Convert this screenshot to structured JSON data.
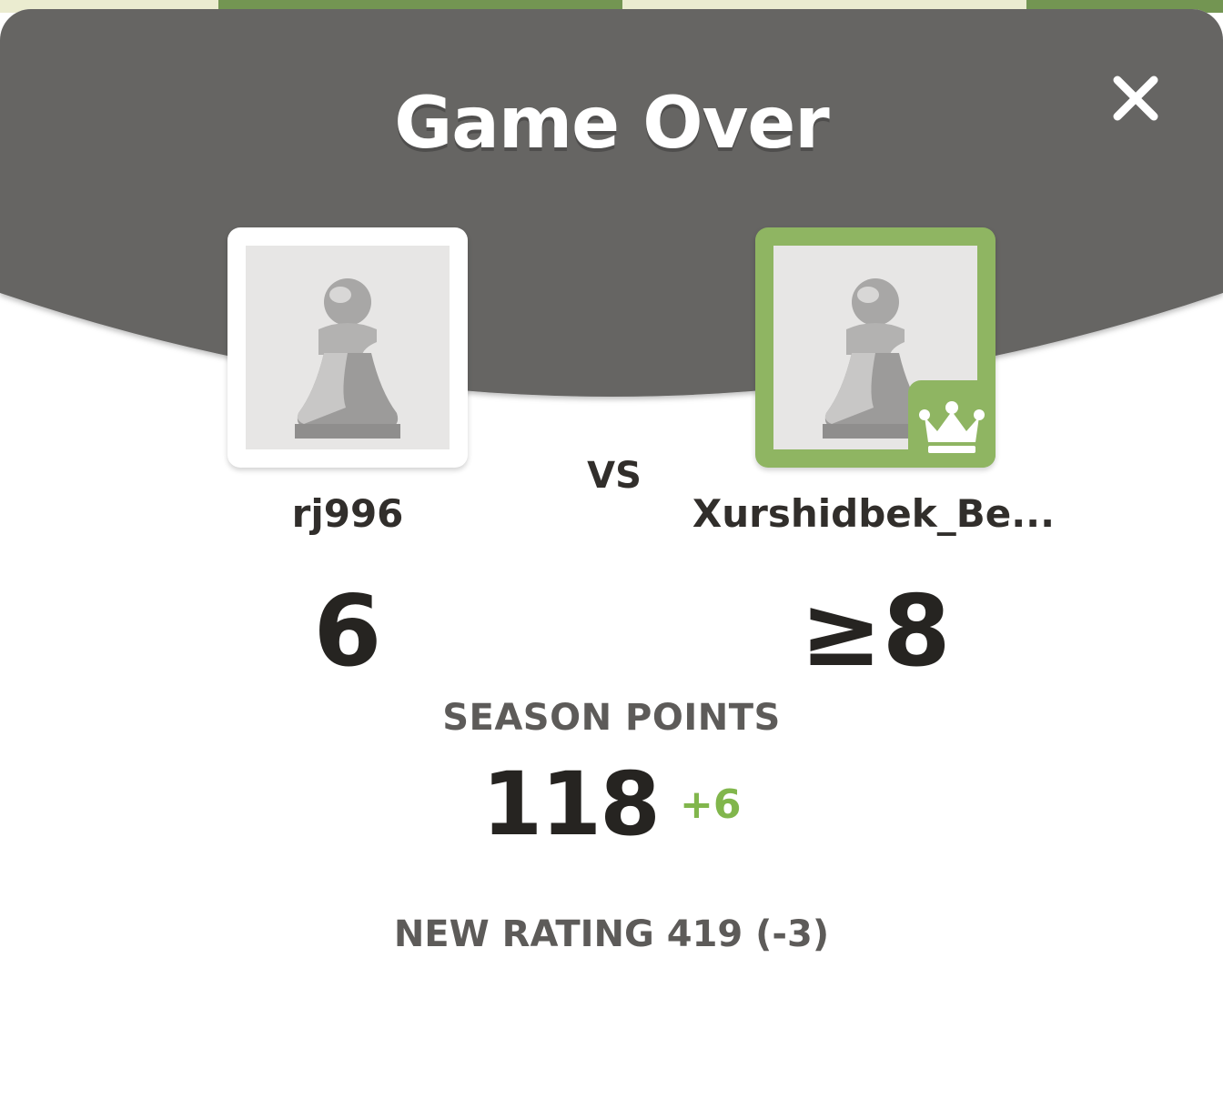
{
  "modal": {
    "title": "Game Over",
    "close_icon": "close-icon",
    "header_color": "#666564",
    "accent_color": "#81b64c"
  },
  "players": {
    "left": {
      "name": "rj996",
      "score": "6",
      "avatar_icon": "pawn-icon",
      "winner": false
    },
    "vs_label": "VS",
    "right": {
      "name": "Xurshidbek_Be...",
      "score": "≥8",
      "avatar_icon": "pawn-icon",
      "badge_icon": "crown-icon",
      "winner": true
    }
  },
  "season": {
    "label": "SEASON POINTS",
    "value": "118",
    "delta": "+6"
  },
  "rating": {
    "text": "NEW RATING 419 (-3)"
  }
}
